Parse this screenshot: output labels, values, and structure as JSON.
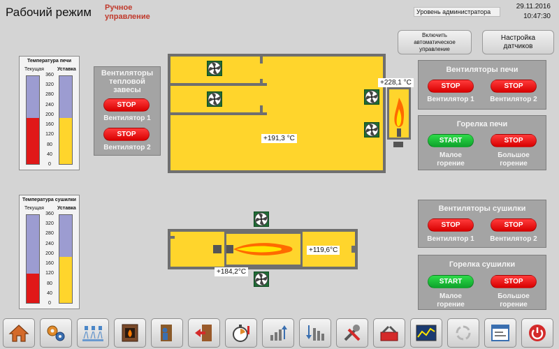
{
  "header": {
    "title": "Рабочий режим",
    "mode_line1": "Ручное",
    "mode_line2": "управление",
    "access_level": "Уровень администратора",
    "date": "29.11.2016",
    "time": "10:47:30"
  },
  "top_buttons": {
    "auto_line1": "Включить",
    "auto_line2": "автоматическое",
    "auto_line3": "управление",
    "sensors_line1": "Настройка",
    "sensors_line2": "датчиков"
  },
  "gauge_furnace": {
    "title": "Температура печи",
    "current_label": "Текущая",
    "setpoint_label": "Уставка",
    "current_value": 190,
    "setpoint_value": 190,
    "max": 360,
    "ticks": [
      "360",
      "320",
      "280",
      "240",
      "200",
      "160",
      "120",
      "80",
      "40",
      "0"
    ],
    "current_color": "#e01818",
    "setpoint_color": "#ffd52c"
  },
  "gauge_dryer": {
    "title": "Температура сушилки",
    "current_label": "Текущая",
    "setpoint_label": "Уставка",
    "current_value": 120,
    "setpoint_value": 190,
    "max": 360,
    "ticks": [
      "360",
      "320",
      "280",
      "240",
      "200",
      "160",
      "120",
      "80",
      "40",
      "0"
    ],
    "current_color": "#e01818",
    "setpoint_color": "#ffd52c"
  },
  "curtain_panel": {
    "title_line1": "Вентиляторы",
    "title_line2": "тепловой",
    "title_line3": "завесы",
    "btn1": "STOP",
    "label1": "Вентилятор 1",
    "btn2": "STOP",
    "label2": "Вентилятор 2"
  },
  "furnace_fans_panel": {
    "title": "Вентиляторы печи",
    "btn1": "STOP",
    "label1": "Вентилятор 1",
    "btn2": "STOP",
    "label2": "Вентилятор 2"
  },
  "furnace_burner_panel": {
    "title": "Горелка печи",
    "btn1": "START",
    "label1_line1": "Малое",
    "label1_line2": "горение",
    "btn2": "STOP",
    "label2_line1": "Большое",
    "label2_line2": "горение"
  },
  "dryer_fans_panel": {
    "title": "Вентиляторы сушилки",
    "btn1": "STOP",
    "label1": "Вентилятор 1",
    "btn2": "STOP",
    "label2": "Вентилятор 2"
  },
  "dryer_burner_panel": {
    "title": "Горелка сушилки",
    "btn1": "START",
    "label1_line1": "Малое",
    "label1_line2": "горение",
    "btn2": "STOP",
    "label2_line1": "Большое",
    "label2_line2": "горение"
  },
  "temps": {
    "furnace_main": "+191,3 °C",
    "furnace_burner": "+228,1 °C",
    "dryer_main": "+119,6°C",
    "dryer_burner": "+184,2°C"
  },
  "colors": {
    "stop": "#e00000",
    "start": "#11b531",
    "chamber": "#ffd52c",
    "wall": "#6f6f6f",
    "panel": "#a4a4a4",
    "title_red": "#c0392b"
  },
  "toolbar_icons": [
    "home-icon",
    "settings-gears-icon",
    "sprinkler-icon",
    "furnace-icon",
    "person-door-icon",
    "exit-door-icon",
    "stopwatch-icon",
    "bars-up-icon",
    "bars-down-icon",
    "tools-icon",
    "toolbox-icon",
    "trend-chart-icon",
    "refresh-icon",
    "window-icon",
    "power-icon"
  ]
}
